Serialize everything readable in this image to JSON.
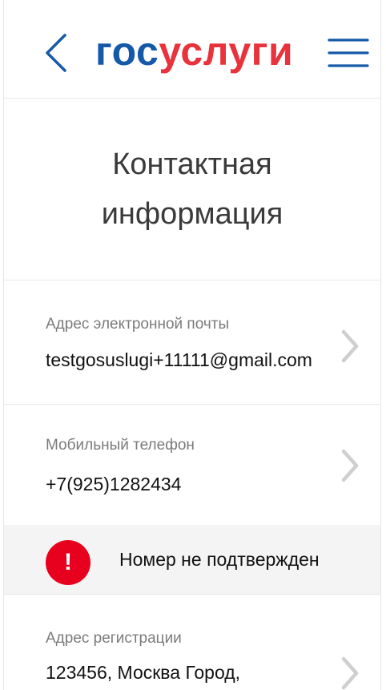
{
  "header": {
    "logo_part1": "гос",
    "logo_part2": "услуги",
    "back_icon": "chevron-left-icon",
    "menu_icon": "hamburger-menu-icon"
  },
  "page": {
    "title": "Контактная информация"
  },
  "contacts": {
    "email": {
      "label": "Адрес электронной почты",
      "value": "testgosuslugi+11111@gmail.com"
    },
    "phone": {
      "label": "Мобильный телефон",
      "value": "+7(925)1282434"
    },
    "phone_warning": {
      "icon_text": "!",
      "text": "Номер не подтвержден"
    },
    "address": {
      "label": "Адрес регистрации",
      "value": "123456, Москва Город,"
    }
  },
  "colors": {
    "brand_blue": "#1659a8",
    "brand_red": "#e8323c",
    "warning_red": "#e8001f"
  }
}
